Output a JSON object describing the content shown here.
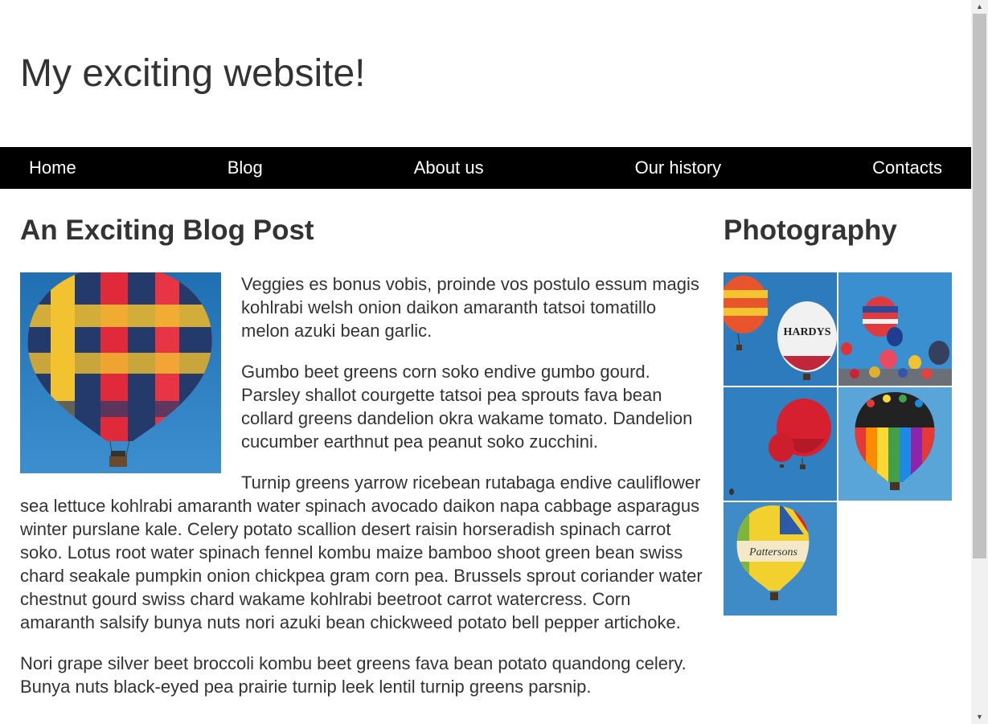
{
  "site": {
    "title": "My exciting website!"
  },
  "nav": {
    "items": [
      {
        "label": "Home"
      },
      {
        "label": "Blog"
      },
      {
        "label": "About us"
      },
      {
        "label": "Our history"
      },
      {
        "label": "Contacts"
      }
    ]
  },
  "post": {
    "heading": "An Exciting Blog Post",
    "image_icon": "hot-air-balloon",
    "paragraphs": [
      "Veggies es bonus vobis, proinde vos postulo essum magis kohlrabi welsh onion daikon amaranth tatsoi tomatillo melon azuki bean garlic.",
      "Gumbo beet greens corn soko endive gumbo gourd. Parsley shallot courgette tatsoi pea sprouts fava bean collard greens dandelion okra wakame tomato. Dandelion cucumber earthnut pea peanut soko zucchini.",
      "Turnip greens yarrow ricebean rutabaga endive cauliflower sea lettuce kohlrabi amaranth water spinach avocado daikon napa cabbage asparagus winter purslane kale. Celery potato scallion desert raisin horseradish spinach carrot soko. Lotus root water spinach fennel kombu maize bamboo shoot green bean swiss chard seakale pumpkin onion chickpea gram corn pea. Brussels sprout coriander water chestnut gourd swiss chard wakame kohlrabi beetroot carrot watercress. Corn amaranth salsify bunya nuts nori azuki bean chickweed potato bell pepper artichoke.",
      "Nori grape silver beet broccoli kombu beet greens fava bean potato quandong celery. Bunya nuts black-eyed pea prairie turnip leek lentil turnip greens parsnip."
    ]
  },
  "sidebar": {
    "heading": "Photography",
    "photos": [
      {
        "icon": "balloons-hardys",
        "balloon_text": "HARDYS"
      },
      {
        "icon": "balloons-festival"
      },
      {
        "icon": "balloons-red"
      },
      {
        "icon": "balloon-rainbow"
      },
      {
        "icon": "balloon-pattersons",
        "balloon_text": "Pattersons"
      }
    ]
  },
  "colors": {
    "nav_background": "#000000",
    "nav_text": "#ffffff",
    "body_text": "#333333",
    "sky_blue": "#2b82c6"
  }
}
